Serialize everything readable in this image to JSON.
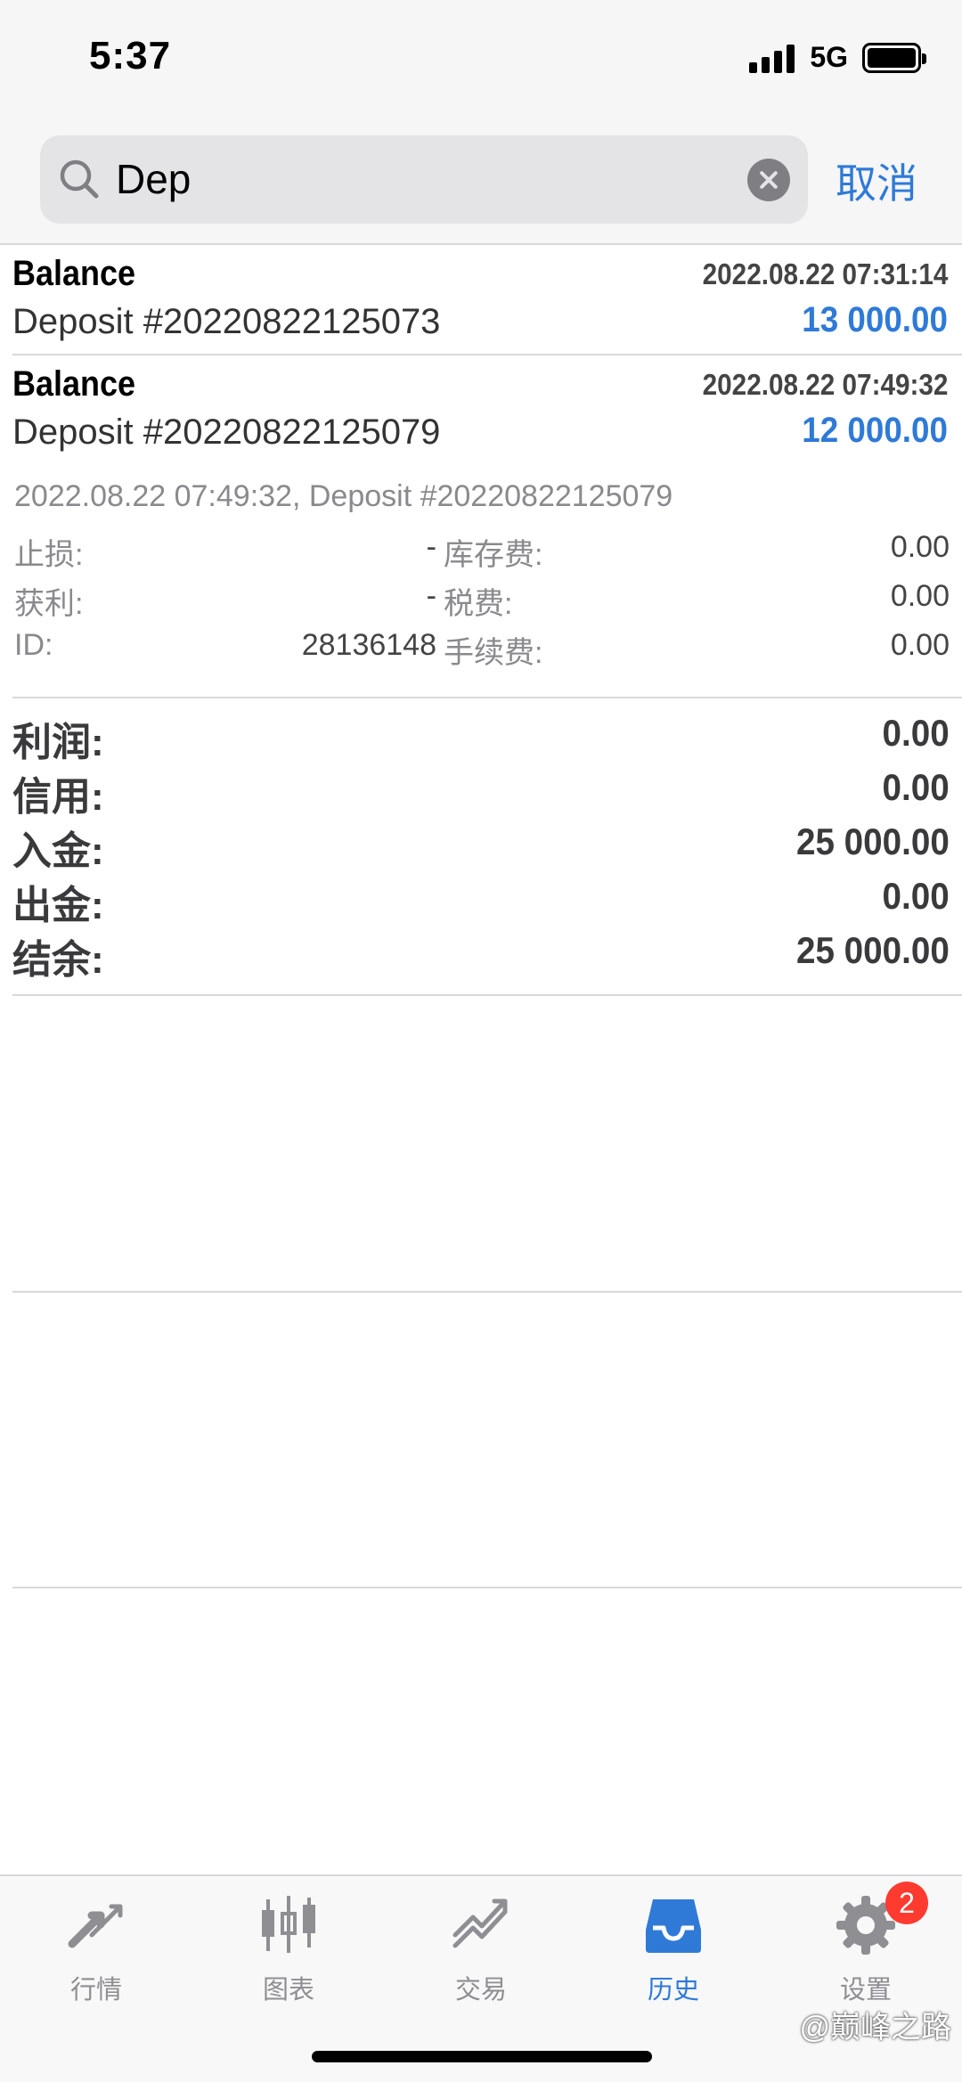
{
  "status_bar": {
    "time": "5:37",
    "network": "5G"
  },
  "search": {
    "value": "Dep",
    "cancel_label": "取消"
  },
  "deals": [
    {
      "type": "Balance",
      "time": "2022.08.22 07:31:14",
      "comment": "Deposit #20220822125073",
      "amount": "13 000.00"
    },
    {
      "type": "Balance",
      "time": "2022.08.22 07:49:32",
      "comment": "Deposit #20220822125079",
      "amount": "12 000.00"
    }
  ],
  "details": {
    "header": "2022.08.22 07:49:32, Deposit #20220822125079",
    "rows": [
      {
        "label1": "止损:",
        "value1": "-",
        "label2": "库存费:",
        "value2": "0.00"
      },
      {
        "label1": "获利:",
        "value1": "-",
        "label2": "税费:",
        "value2": "0.00"
      },
      {
        "label1": "ID:",
        "value1": "28136148",
        "label2": "手续费:",
        "value2": "0.00"
      }
    ]
  },
  "summary": [
    {
      "label": "利润:",
      "value": "0.00"
    },
    {
      "label": "信用:",
      "value": "0.00"
    },
    {
      "label": "入金:",
      "value": "25 000.00"
    },
    {
      "label": "出金:",
      "value": "0.00"
    },
    {
      "label": "结余:",
      "value": "25 000.00"
    }
  ],
  "tabs": [
    {
      "label": "行情",
      "icon": "quotes-arrows-icon",
      "active": false
    },
    {
      "label": "图表",
      "icon": "candlestick-chart-icon",
      "active": false
    },
    {
      "label": "交易",
      "icon": "trade-trend-icon",
      "active": false
    },
    {
      "label": "历史",
      "icon": "history-inbox-icon",
      "active": true
    },
    {
      "label": "设置",
      "icon": "gear-icon",
      "active": false,
      "badge": "2"
    }
  ],
  "watermark": "@巅峰之路",
  "colors": {
    "accent": "#2f7ad7",
    "badge": "#ff3b30",
    "inactive_tab": "#8e8e93"
  }
}
